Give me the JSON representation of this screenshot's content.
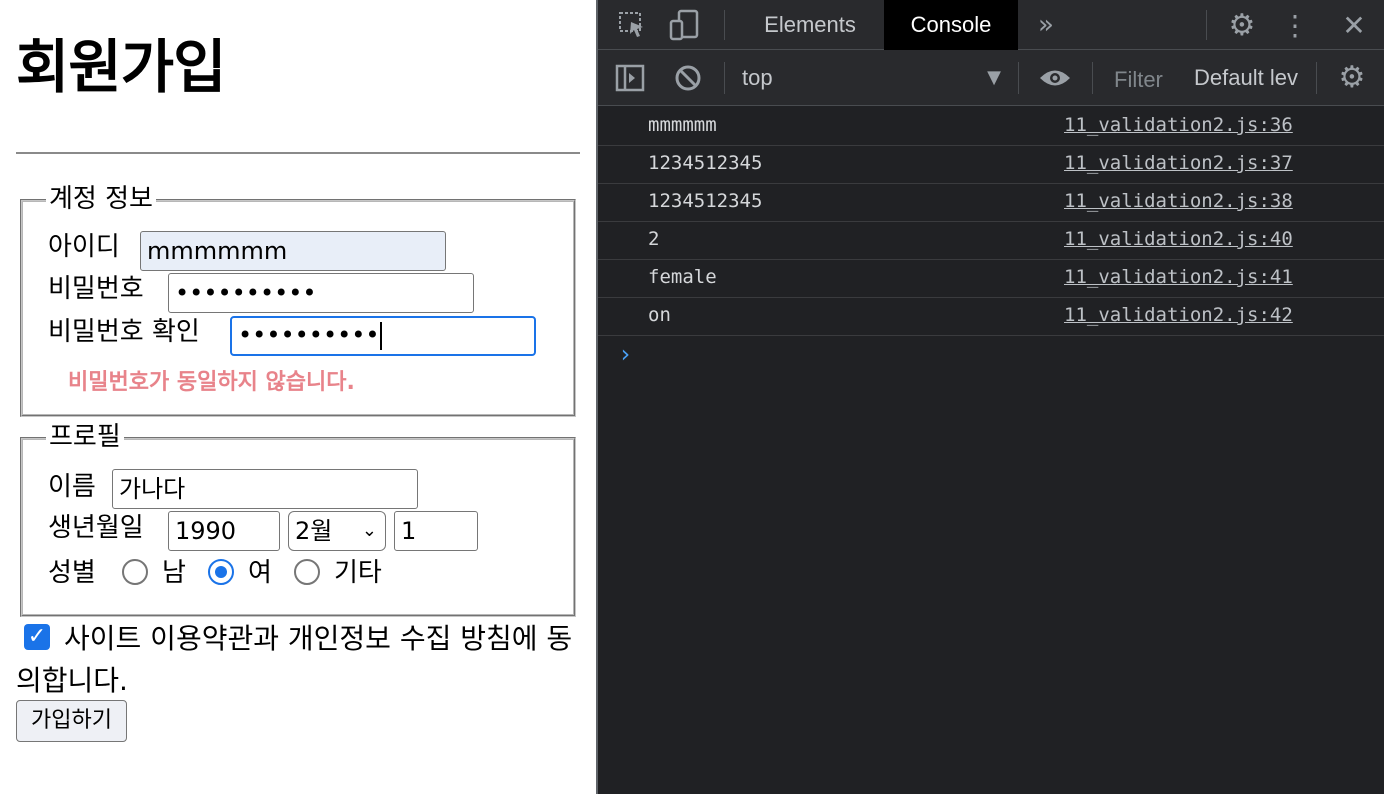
{
  "page": {
    "title": "회원가입",
    "account": {
      "legend": "계정 정보",
      "id_label": "아이디",
      "id_value": "mmmmmm",
      "pw_label": "비밀번호",
      "pw_value": "••••••••••",
      "pw_confirm_label": "비밀번호 확인",
      "pw_confirm_value": "••••••••••",
      "error": "비밀번호가 동일하지 않습니다."
    },
    "profile": {
      "legend": "프로필",
      "name_label": "이름",
      "name_value": "가나다",
      "birth_label": "생년월일",
      "birth_year": "1990",
      "birth_month": "2월",
      "birth_day": "1",
      "gender_label": "성별",
      "gender_options": [
        "남",
        "여",
        "기타"
      ],
      "gender_selected": "여"
    },
    "agree_text": "사이트 이용약관과 개인정보 수집 방침에 동의합니다.",
    "agree_checked": true,
    "submit_label": "가입하기"
  },
  "devtools": {
    "tabs": [
      "Elements",
      "Console"
    ],
    "active_tab": "Console",
    "more_tabs_icon": "chevron-double-right-icon",
    "context": "top",
    "filter_placeholder": "Filter",
    "levels": "Default lev",
    "logs": [
      {
        "message": "mmmmmm",
        "source": "11_validation2.js:36"
      },
      {
        "message": "1234512345",
        "source": "11_validation2.js:37"
      },
      {
        "message": "1234512345",
        "source": "11_validation2.js:38"
      },
      {
        "message": "2",
        "source": "11_validation2.js:40"
      },
      {
        "message": "female",
        "source": "11_validation2.js:41"
      },
      {
        "message": "on",
        "source": "11_validation2.js:42"
      }
    ],
    "prompt_symbol": "›"
  },
  "colors": {
    "accent": "#1a73e8",
    "error": "#e8838a",
    "devtools_bg": "#202124",
    "devtools_toolbar": "#292a2d",
    "autofill_bg": "#e8eef8"
  }
}
